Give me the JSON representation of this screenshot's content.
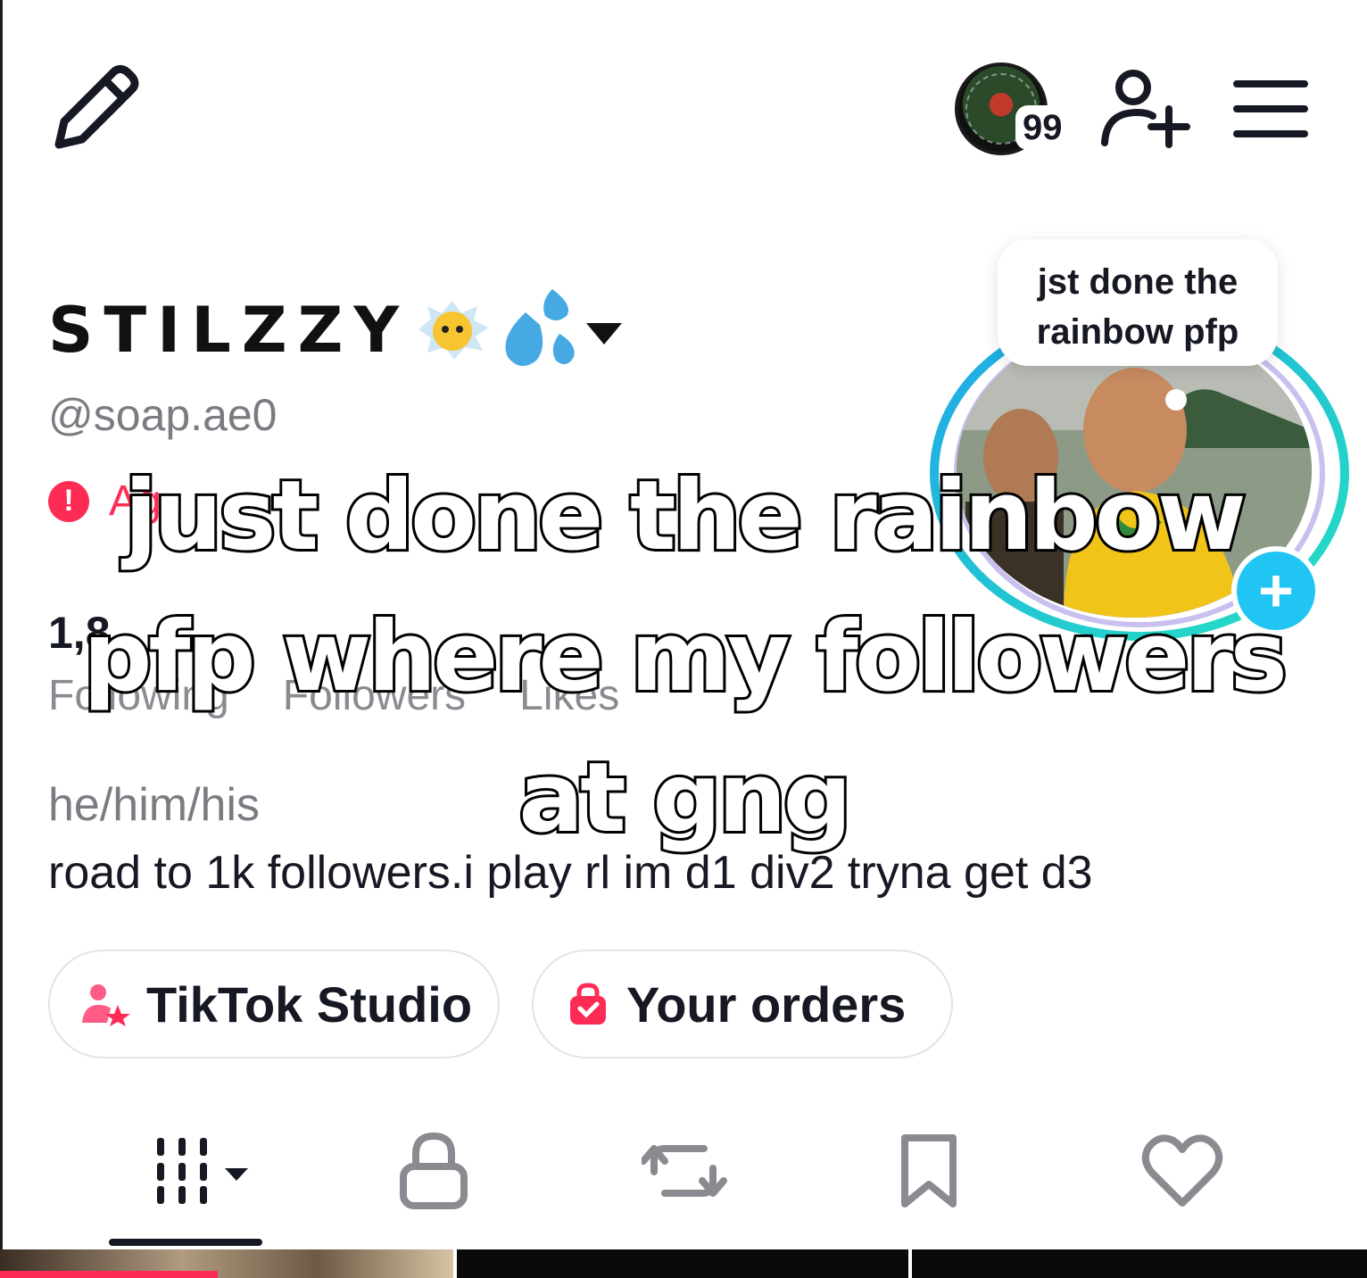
{
  "header": {
    "story_count": "99"
  },
  "profile": {
    "display_name": "STILZZY",
    "handle": "@soap.ae0",
    "warning_text": "Ag",
    "stats_number": "1,8",
    "stats_labels": [
      "Following",
      "Followers",
      "Likes"
    ],
    "pronouns": "he/him/his",
    "bio": "road to 1k followers.i play rl im d1 div2 tryna get d3"
  },
  "note": {
    "text_line1": "jst done the",
    "text_line2": "rainbow pfp"
  },
  "buttons": {
    "studio_label": "TikTok Studio",
    "orders_label": "Your orders"
  },
  "caption": {
    "line1": "just done the rainbow",
    "line2": "pfp where my followers",
    "line3": "at gng"
  },
  "colors": {
    "accent": "#fe2c55",
    "add_button": "#20c5f3",
    "ring_start": "#1fa7e8",
    "ring_end": "#25e0c0"
  },
  "icons": {
    "edit": "pencil-icon",
    "add_friend": "add-person-icon",
    "menu": "hamburger-icon",
    "videos": "grid-icon",
    "private": "lock-icon",
    "reposts": "repost-icon",
    "saved": "bookmark-icon",
    "liked": "heart-icon"
  }
}
